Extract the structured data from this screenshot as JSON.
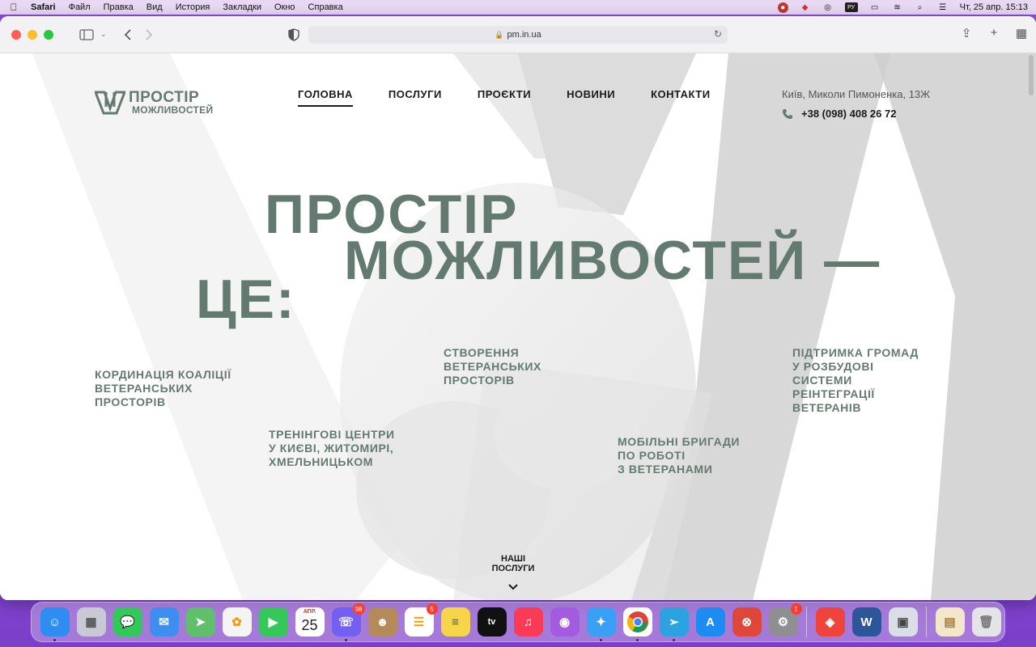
{
  "menubar": {
    "app": "Safari",
    "items": [
      "Файл",
      "Правка",
      "Вид",
      "История",
      "Закладки",
      "Окно",
      "Справка"
    ],
    "keyboard_layout": "РУ",
    "clock": "Чт, 25 апр.  15:13"
  },
  "browser": {
    "url": "pm.in.ua"
  },
  "site": {
    "logo": {
      "line1": "ПРОСТІР",
      "line2": "МОЖЛИВОСТЕЙ"
    },
    "nav": [
      {
        "label": "ГОЛОВНА",
        "active": true
      },
      {
        "label": "ПОСЛУГИ",
        "active": false
      },
      {
        "label": "ПРОЄКТИ",
        "active": false
      },
      {
        "label": "НОВИНИ",
        "active": false
      },
      {
        "label": "КОНТАКТИ",
        "active": false
      }
    ],
    "address": "Київ, Миколи Пимоненка, 13Ж",
    "phone": "+38 (098) 408 26 72",
    "hero": {
      "line1": "ПРОСТІР",
      "line2": "МОЖЛИВОСТЕЙ —",
      "line3": "ЦЕ:"
    },
    "features": [
      "КОРДИНАЦІЯ КОАЛІЦІЇ\nВЕТЕРАНСЬКИХ\nПРОСТОРІВ",
      "ТРЕНІНГОВІ ЦЕНТРИ\nУ КИЄВІ, ЖИТОМИРІ,\nХМЕЛЬНИЦЬКОМ",
      "СТВОРЕННЯ\nВЕТЕРАНСЬКИХ\nПРОСТОРІВ",
      "МОБІЛЬНІ БРИГАДИ\nПО РОБОТІ\nЗ ВЕТЕРАНАМИ",
      "ПІДТРИМКА ГРОМАД\nУ РОЗБУДОВІ\nСИСТЕМИ\nРЕІНТЕГРАЦІЇ\nВЕТЕРАНІВ"
    ],
    "services_link": "НАШІ\nПОСЛУГИ",
    "accent_color": "#637a70"
  },
  "dock": {
    "apps": [
      {
        "name": "finder",
        "color": "#2f8cf0"
      },
      {
        "name": "launchpad",
        "color": "#c9c9d6"
      },
      {
        "name": "messages",
        "color": "#34c759"
      },
      {
        "name": "mail",
        "color": "#3d8ef0"
      },
      {
        "name": "maps",
        "color": "#5fbf6b"
      },
      {
        "name": "photos",
        "color": "#f4f4f4"
      },
      {
        "name": "facetime",
        "color": "#34c759"
      },
      {
        "name": "calendar",
        "color": "#ffffff",
        "month": "АПР.",
        "day": "25"
      },
      {
        "name": "viber",
        "color": "#7360f2",
        "badge": "98"
      },
      {
        "name": "contacts",
        "color": "#b58a5a"
      },
      {
        "name": "reminders",
        "color": "#ffffff",
        "badge": "5"
      },
      {
        "name": "notes",
        "color": "#f7d54a"
      },
      {
        "name": "apple-tv",
        "color": "#111111"
      },
      {
        "name": "music",
        "color": "#fa3b55"
      },
      {
        "name": "podcasts",
        "color": "#a35be0"
      },
      {
        "name": "safari",
        "color": "#3aa0f5"
      },
      {
        "name": "chrome",
        "color": "#ffffff"
      },
      {
        "name": "telegram",
        "color": "#2aa3e0"
      },
      {
        "name": "app-store",
        "color": "#1d8cf0"
      },
      {
        "name": "remote-desktop",
        "color": "#e0473b"
      },
      {
        "name": "system-settings",
        "color": "#8e8e93",
        "badge": "1"
      },
      {
        "name": "anydesk",
        "color": "#ef443b"
      },
      {
        "name": "word",
        "color": "#2b579a"
      },
      {
        "name": "preview",
        "color": "#d8dde6"
      },
      {
        "name": "document",
        "color": "#f3e7c9"
      },
      {
        "name": "trash",
        "color": "#e3e3e8"
      }
    ]
  }
}
